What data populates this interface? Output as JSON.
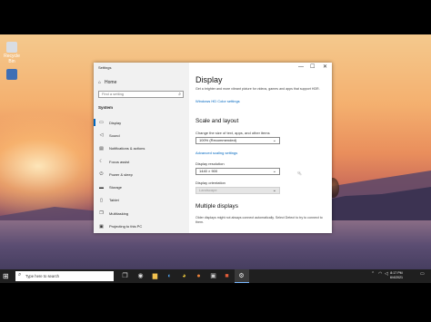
{
  "desktop": {
    "icons": [
      {
        "label": "Recycle Bin",
        "icon": "recycle-bin-icon"
      },
      {
        "label": "",
        "icon": "document-icon"
      }
    ]
  },
  "window": {
    "title": "Settings",
    "controls": {
      "minimize": "—",
      "maximize": "☐",
      "close": "✕"
    }
  },
  "sidebar": {
    "home_label": "Home",
    "search_placeholder": "Find a setting",
    "section_label": "System",
    "items": [
      {
        "label": "Display",
        "icon": "monitor-icon",
        "glyph": "▭",
        "active": true
      },
      {
        "label": "Sound",
        "icon": "speaker-icon",
        "glyph": "◁"
      },
      {
        "label": "Notifications & actions",
        "icon": "notifications-icon",
        "glyph": "▤"
      },
      {
        "label": "Focus assist",
        "icon": "moon-icon",
        "glyph": "☾"
      },
      {
        "label": "Power & sleep",
        "icon": "power-icon",
        "glyph": "⏻"
      },
      {
        "label": "Storage",
        "icon": "storage-icon",
        "glyph": "▬"
      },
      {
        "label": "Tablet",
        "icon": "tablet-icon",
        "glyph": "▯"
      },
      {
        "label": "Multitasking",
        "icon": "multitasking-icon",
        "glyph": "❐"
      },
      {
        "label": "Projecting to this PC",
        "icon": "projecting-icon",
        "glyph": "▣"
      }
    ]
  },
  "main": {
    "title": "Display",
    "description": "Get a brighter and more vibrant picture for videos, games and apps that support HDR.",
    "hdr_link": "Windows HD Color settings",
    "scale_heading": "Scale and layout",
    "scale_label": "Change the size of text, apps, and other items",
    "scale_value": "100% (Recommended)",
    "advanced_link": "Advanced scaling settings",
    "resolution_label": "Display resolution",
    "resolution_value": "1440 × 900",
    "orientation_label": "Display orientation",
    "orientation_value": "Landscape",
    "multiple_heading": "Multiple displays",
    "multiple_desc": "Older displays might not always connect automatically. Select Detect to try to connect to them."
  },
  "taskbar": {
    "search_placeholder": "Type here to search",
    "clock_time": "8:17 PM",
    "clock_date": "6/4/2021"
  },
  "colors": {
    "accent": "#0067c0",
    "sidebar_bg": "#f1f1f1",
    "taskbar_bg": "#1f1f1f"
  }
}
